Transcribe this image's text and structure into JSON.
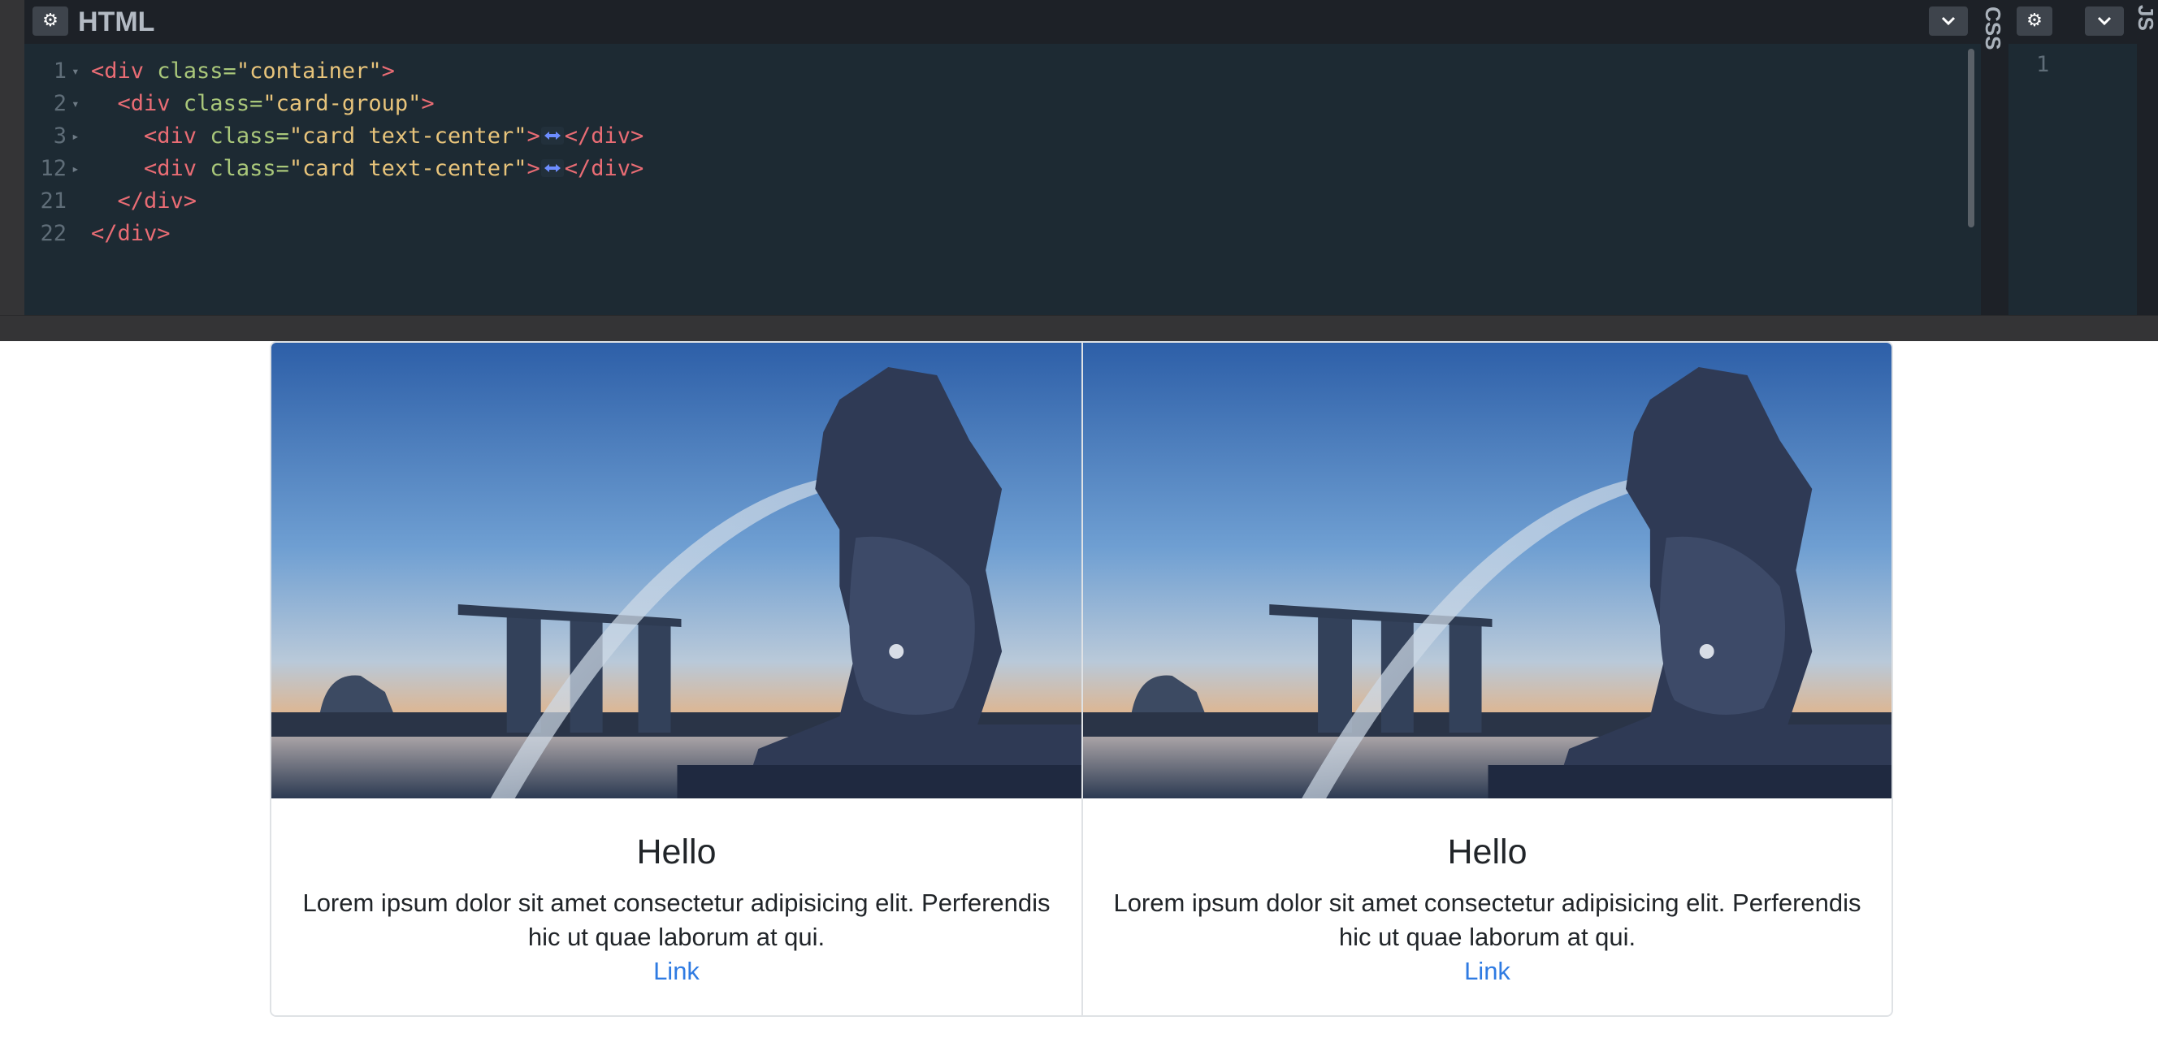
{
  "editor": {
    "html_panel": {
      "title": "HTML",
      "settings_icon": "gear-icon",
      "collapse_icon": "chevron-down-icon",
      "lines": [
        {
          "number": "1",
          "folded": false,
          "parts": [
            [
              "tag",
              "<div "
            ],
            [
              "attr",
              "class="
            ],
            [
              "str",
              "\"container\""
            ],
            [
              "tag",
              ">"
            ]
          ]
        },
        {
          "number": "2",
          "folded": false,
          "parts": [
            [
              "plain",
              "  "
            ],
            [
              "tag",
              "<div "
            ],
            [
              "attr",
              "class="
            ],
            [
              "str",
              "\"card-group\""
            ],
            [
              "tag",
              ">"
            ]
          ]
        },
        {
          "number": "3",
          "folded": true,
          "parts": [
            [
              "plain",
              "    "
            ],
            [
              "tag",
              "<div "
            ],
            [
              "attr",
              "class="
            ],
            [
              "str",
              "\"card text-center\""
            ],
            [
              "tag",
              ">"
            ],
            [
              "marker",
              ""
            ],
            [
              "tag",
              "</div>"
            ]
          ]
        },
        {
          "number": "12",
          "folded": true,
          "parts": [
            [
              "plain",
              "    "
            ],
            [
              "tag",
              "<div "
            ],
            [
              "attr",
              "class="
            ],
            [
              "str",
              "\"card text-center\""
            ],
            [
              "tag",
              ">"
            ],
            [
              "marker",
              ""
            ],
            [
              "tag",
              "</div>"
            ]
          ]
        },
        {
          "number": "21",
          "folded": null,
          "parts": [
            [
              "plain",
              "  "
            ],
            [
              "tag",
              "</div>"
            ]
          ]
        },
        {
          "number": "22",
          "folded": null,
          "parts": [
            [
              "tag",
              "</div>"
            ]
          ]
        }
      ]
    },
    "css_panel": {
      "title": "CSS"
    },
    "js_panel": {
      "title": "JS",
      "settings_icon": "gear-icon",
      "collapse_icon": "chevron-down-icon",
      "line_number": "1"
    }
  },
  "preview": {
    "cards": [
      {
        "image": "merlion-singapore-sunset-photo",
        "title": "Hello",
        "text": "Lorem ipsum dolor sit amet consectetur adipisicing elit. Perferendis hic ut quae laborum at qui.",
        "link": "Link"
      },
      {
        "image": "merlion-singapore-sunset-photo",
        "title": "Hello",
        "text": "Lorem ipsum dolor sit amet consectetur adipisicing elit. Perferendis hic ut quae laborum at qui.",
        "link": "Link"
      }
    ]
  },
  "colors": {
    "tag": "#e96c74",
    "attribute": "#a9c77a",
    "string": "#e8c47b",
    "link": "#2f7be2",
    "editor_bg": "#1d2a33"
  }
}
